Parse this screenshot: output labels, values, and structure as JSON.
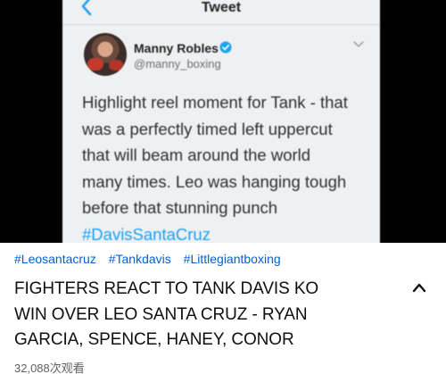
{
  "tweet": {
    "header_title": "Tweet",
    "user_name": "Manny Robles",
    "user_handle": "@manny_boxing",
    "body_lines": [
      "Highlight reel moment for Tank - that",
      "was a perfectly timed left uppercut",
      "that will beam around the world",
      "many times. Leo was hanging tough",
      "before that stunning punch"
    ],
    "hashtag": "#DavisSantaCruz",
    "icons": {
      "back": "chevron-left-icon",
      "verified": "verified-badge-icon",
      "menu": "chevron-down-icon"
    },
    "accent_color": "#1da1f2"
  },
  "video_info": {
    "tags": [
      "#Leosantacruz",
      "#Tankdavis",
      "#Littlegiantboxing"
    ],
    "title_lines": [
      "FIGHTERS REACT TO TANK DAVIS KO",
      "WIN OVER LEO SANTA CRUZ - RYAN",
      "GARCIA, SPENCE, HANEY, CONOR"
    ],
    "view_count": "32,088次观看",
    "collapse_icon": "chevron-up-icon",
    "tag_color": "#065fd4"
  }
}
